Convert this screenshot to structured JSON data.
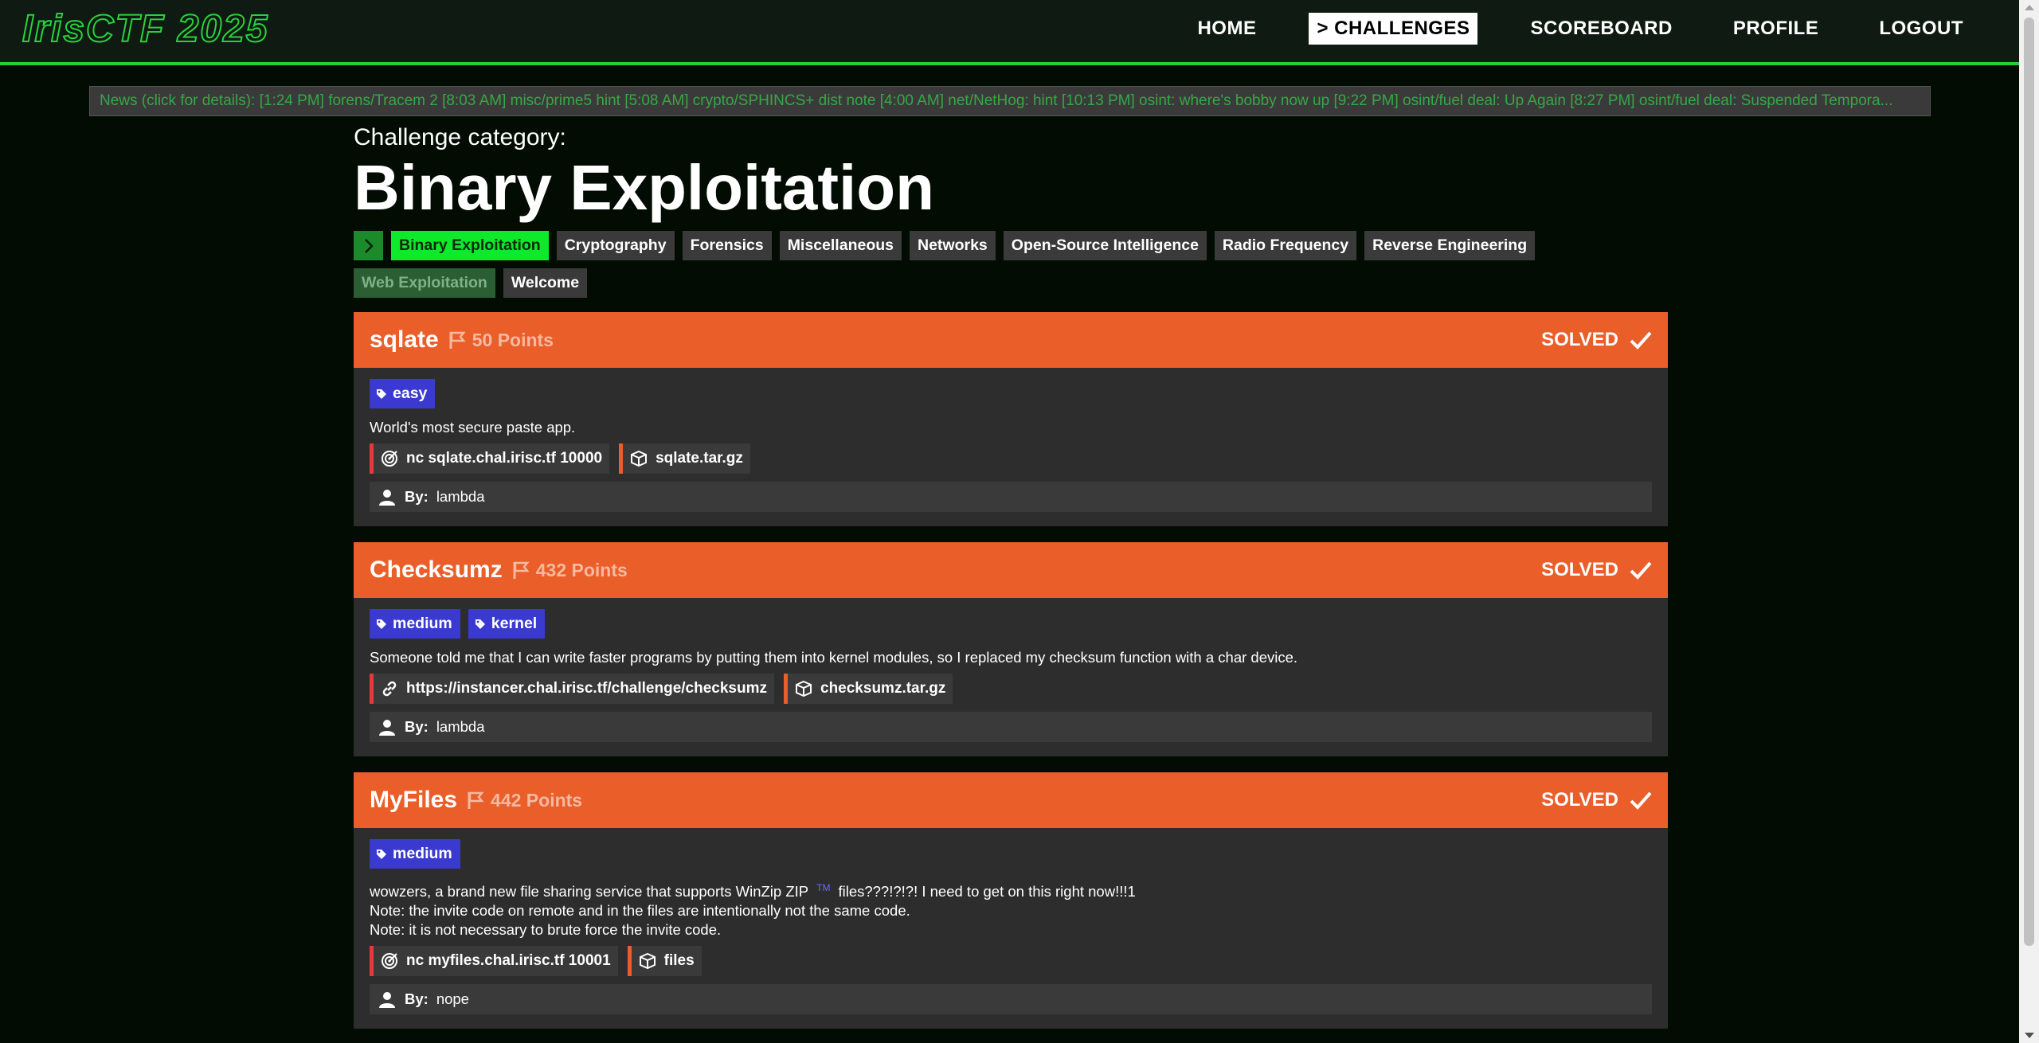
{
  "brand": {
    "logo_text": "IrisCTF 2025",
    "accent": "#22d13a"
  },
  "nav": {
    "home": "HOME",
    "challenges": "> CHALLENGES",
    "scoreboard": "SCOREBOARD",
    "profile": "PROFILE",
    "logout": "LOGOUT"
  },
  "ticker": {
    "text": "News (click for details): [1:24 PM] forens/Tracem 2 [8:03 AM] misc/prime5 hint [5:08 AM] crypto/SPHINCS+ dist note [4:00 AM] net/NetHog: hint [10:13 PM] osint: where's bobby now up [9:22 PM] osint/fuel deal: Up Again [8:27 PM] osint/fuel deal: Suspended Tempora..."
  },
  "category": {
    "label": "Challenge category:",
    "title": "Binary Exploitation",
    "buttons": [
      "Binary Exploitation",
      "Cryptography",
      "Forensics",
      "Miscellaneous",
      "Networks",
      "Open-Source Intelligence",
      "Radio Frequency",
      "Reverse Engineering",
      "Web Exploitation",
      "Welcome"
    ]
  },
  "challenges": [
    {
      "name": "sqlate",
      "points": "50 Points",
      "status": "SOLVED",
      "tags": [
        "easy"
      ],
      "description": "World's most secure paste app.",
      "links": [
        "nc sqlate.chal.irisc.tf 10000",
        "sqlate.tar.gz"
      ],
      "by_label": "By:",
      "author": "lambda"
    },
    {
      "name": "Checksumz",
      "points": "432 Points",
      "status": "SOLVED",
      "tags": [
        "medium",
        "kernel"
      ],
      "description": "Someone told me that I can write faster programs by putting them into kernel modules, so I replaced my checksum function with a char device.",
      "links": [
        "https://instancer.chal.irisc.tf/challenge/checksumz",
        "checksumz.tar.gz"
      ],
      "by_label": "By:",
      "author": "lambda"
    },
    {
      "name": "MyFiles",
      "points": "442 Points",
      "status": "SOLVED",
      "tags": [
        "medium"
      ],
      "description_pre": "wowzers, a brand new file sharing service that supports WinZip ZIP",
      "tm": "TM",
      "description_post": "files???!?!?! I need to get on this right now!!!1",
      "note1": "Note: the invite code on remote and in the files are intentionally not the same code.",
      "note2": "Note: it is not necessary to brute force the invite code.",
      "links": [
        "nc myfiles.chal.irisc.tf 10001",
        "files"
      ],
      "by_label": "By:",
      "author": "nope"
    }
  ],
  "colors": {
    "header_orange": "#ea5e2a",
    "tag_blue": "#3a3ad0",
    "selected_green": "#0fe92b"
  }
}
